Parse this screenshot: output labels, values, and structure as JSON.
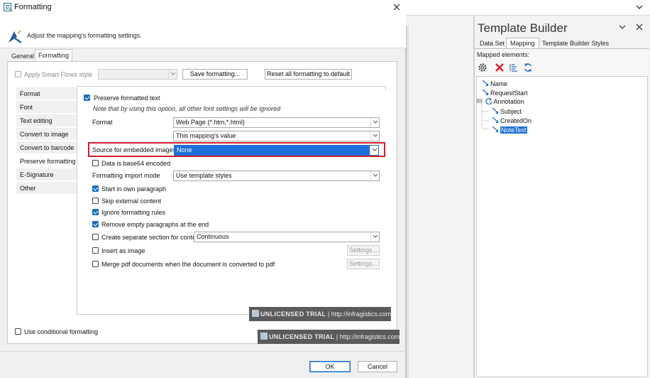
{
  "dialog": {
    "title": "Formatting",
    "header_text": "Adjust the mapping's formatting settings.",
    "tabs": [
      "General",
      "Formatting"
    ],
    "active_tab": "Formatting",
    "apply_smart_flows_label": "Apply Smart Flows style",
    "save_formatting_label": "Save formatting...",
    "reset_formatting_label": "Reset all formatting to default",
    "categories": [
      "Format",
      "Font",
      "Text editing",
      "Convert to image",
      "Convert to barcode",
      "Preserve formatting",
      "E-Signature",
      "Other"
    ],
    "active_category": "Preserve formatting",
    "preserve_formatted_text_label": "Preserve formatted text",
    "note": "Note that by using this option, all other font settings will be ignored",
    "format_label": "Format",
    "format_value": "Web Page (*.htm,*.html)",
    "format_sub_value": "This mapping's value",
    "source_images_label": "Source for embedded images",
    "source_images_value": "None",
    "base64_label": "Data is base64 encoded",
    "import_mode_label": "Formatting import mode",
    "import_mode_value": "Use template styles",
    "start_paragraph_label": "Start in own paragraph",
    "skip_external_label": "Skip external content",
    "ignore_rules_label": "Ignore formatting rules",
    "remove_empty_label": "Remove empty paragraphs at the end",
    "separate_section_label": "Create separate section for content",
    "separate_section_value": "Continuous",
    "insert_image_label": "Insert as image",
    "merge_pdf_label": "Merge pdf documents when the document is converted to pdf",
    "settings_label": "Settings...",
    "conditional_label": "Use conditional formatting",
    "ok_label": "OK",
    "cancel_label": "Cancel",
    "watermark_a": "UNLICENSED TRIAL",
    "watermark_sep": "|",
    "watermark_b": "http://infragistics.com"
  },
  "checks": {
    "apply_smart_flows": false,
    "preserve_formatted_text": true,
    "base64": false,
    "start_paragraph": true,
    "skip_external": false,
    "ignore_rules": true,
    "remove_empty": true,
    "separate_section": false,
    "insert_image": false,
    "merge_pdf": false,
    "conditional": false
  },
  "template_builder": {
    "title": "Template Builder",
    "tabs": [
      "Data Set",
      "Mapping",
      "Template Builder Styles"
    ],
    "active_tab": "Mapping",
    "mapped_label": "Mapped elements:",
    "tools": [
      "gear-icon",
      "delete-icon",
      "list-icon",
      "refresh-icon"
    ],
    "nodes": [
      "Name",
      "RequestStart",
      "Annotation",
      "Subject",
      "CreatedOn",
      "NoteText"
    ],
    "selected_node": "NoteText"
  },
  "colors": {
    "accent": "#1e6fd9",
    "highlight_border": "#d21f2c",
    "checked": "#1b6fbd",
    "delete_red": "#d9262e"
  }
}
